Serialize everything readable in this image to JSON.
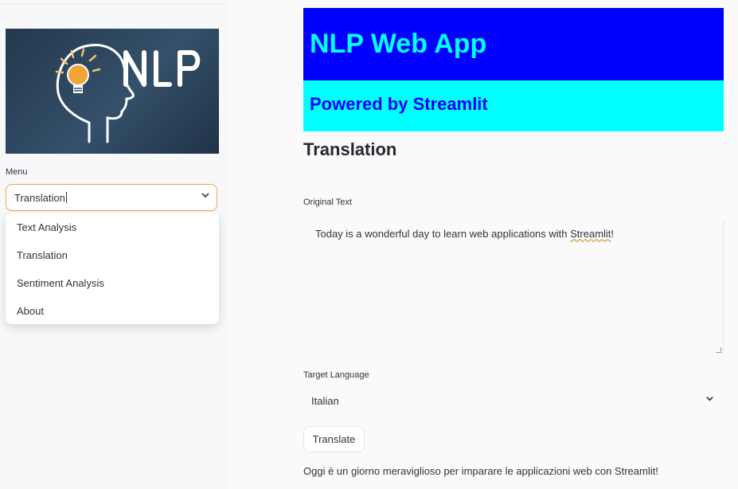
{
  "sidebar": {
    "logo_text": "NLP",
    "menu_label": "Menu",
    "menu_value": "Translation",
    "menu_options": [
      "Text Analysis",
      "Translation",
      "Sentiment Analysis",
      "About"
    ]
  },
  "header": {
    "title": "NLP Web App",
    "subtitle": "Powered by Streamlit"
  },
  "main": {
    "section_title": "Translation",
    "original_text_label": "Original Text",
    "original_text_value_a": "Today is a wonderful day to learn web applications with ",
    "original_text_value_b": "Streamlit",
    "original_text_value_c": "!",
    "target_language_label": "Target Language",
    "target_language_value": "Italian",
    "translate_button": "Translate",
    "result_text": "Oggi è un giorno meraviglioso per imparare le applicazioni web con Streamlit!"
  },
  "colors": {
    "banner_bg": "#0000ff",
    "banner_text": "#00ffff",
    "subbanner_bg": "#00ffff",
    "subbanner_text": "#0000ff",
    "focus_border": "#f0a44d"
  }
}
